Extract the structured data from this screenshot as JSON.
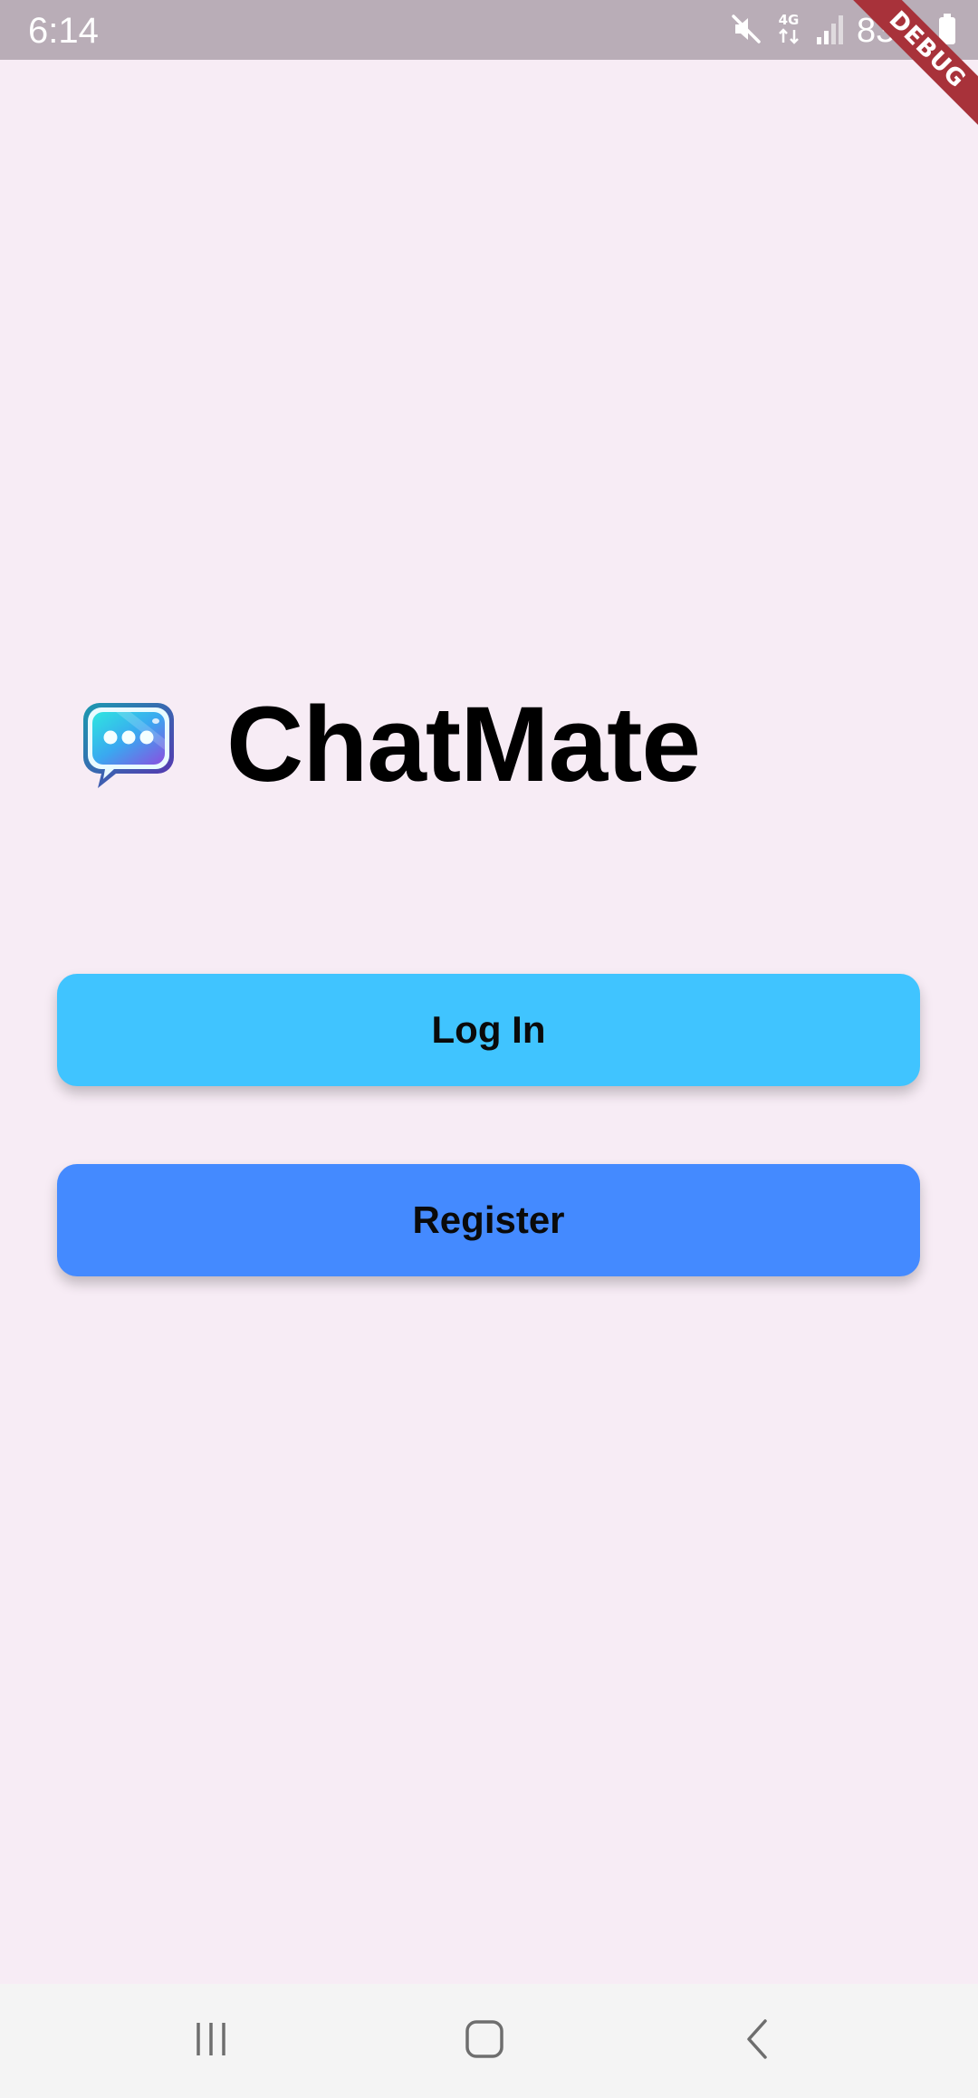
{
  "status_bar": {
    "time": "6:14",
    "battery_text": "83%",
    "network_type": "4G",
    "icons": [
      "mute-icon",
      "network-4g-icon",
      "signal-icon",
      "battery-icon"
    ]
  },
  "debug_banner": {
    "label": "DEBUG"
  },
  "app": {
    "title": "ChatMate",
    "logo_icon": "chat-bubble-icon"
  },
  "buttons": {
    "login_label": "Log In",
    "register_label": "Register"
  },
  "nav_bar": {
    "icons": [
      "recents-icon",
      "home-icon",
      "back-icon"
    ]
  },
  "colors": {
    "background": "#f7ecf5",
    "status_bar": "#b9adb7",
    "login_button": "#40c4ff",
    "register_button": "#448aff",
    "debug_ribbon": "#a8323a",
    "nav_bar": "#f4f4f4"
  }
}
